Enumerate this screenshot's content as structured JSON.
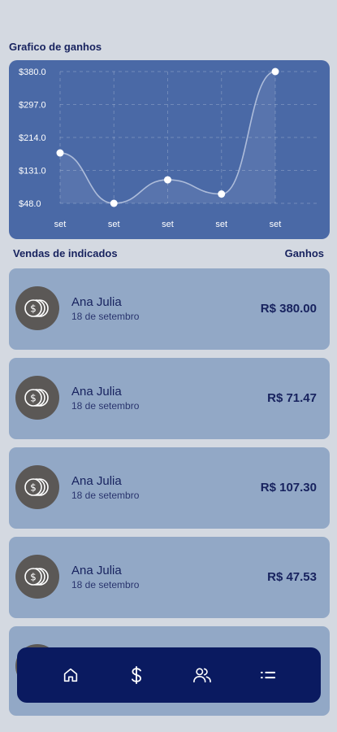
{
  "chart_title": "Grafico de ganhos",
  "chart_data": {
    "type": "line",
    "categories": [
      "set",
      "set",
      "set",
      "set",
      "set"
    ],
    "values": [
      175,
      48,
      107.3,
      71.47,
      380
    ],
    "ytick_labels": [
      "$380.0",
      "$297.0",
      "$214.0",
      "$131.0",
      "$48.0"
    ],
    "ylim": [
      48,
      380
    ],
    "grid": true,
    "colors": {
      "background": "#4a69a6",
      "line": "#c4d0e6",
      "points": "#ffffff"
    }
  },
  "section": {
    "left_label": "Vendas de indicados",
    "right_label": "Ganhos"
  },
  "sales": [
    {
      "name": "Ana Julia",
      "date": "18 de setembro",
      "amount": "R$ 380.00"
    },
    {
      "name": "Ana Julia",
      "date": "18 de setembro",
      "amount": "R$ 71.47"
    },
    {
      "name": "Ana Julia",
      "date": "18 de setembro",
      "amount": "R$ 107.30"
    },
    {
      "name": "Ana Julia",
      "date": "18 de setembro",
      "amount": "R$ 47.53"
    }
  ],
  "nav": [
    {
      "icon": "home-icon"
    },
    {
      "icon": "dollar-icon"
    },
    {
      "icon": "users-icon"
    },
    {
      "icon": "list-icon"
    }
  ]
}
